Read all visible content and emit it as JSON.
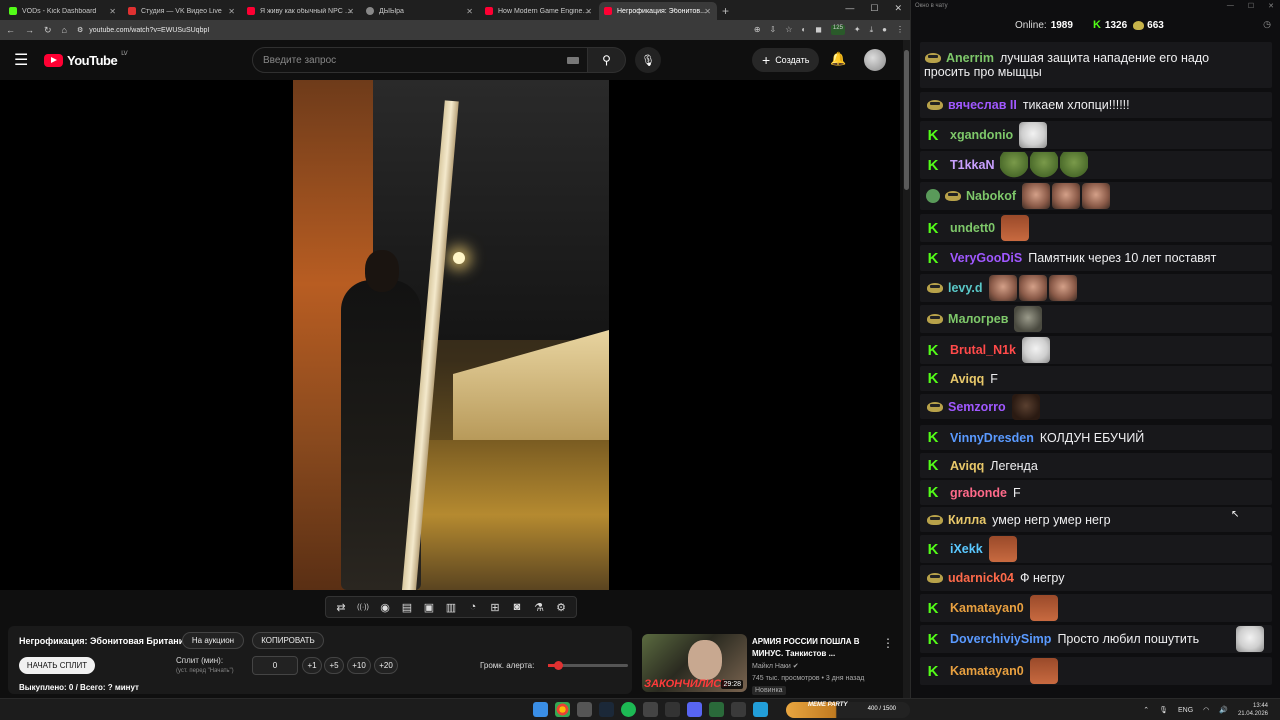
{
  "tabs": [
    {
      "title": "VODs - Kick Dashboard",
      "icon": "kick-icon",
      "active": false
    },
    {
      "title": "Студия — VK Видео Live",
      "icon": "vk-icon",
      "active": false
    },
    {
      "title": "Я живу как обычный NPC в Ki...",
      "icon": "youtube-icon",
      "active": false
    },
    {
      "title": "ДЫЫра",
      "icon": "globe-icon",
      "active": false
    },
    {
      "title": "How Modern Game Engines D...",
      "icon": "youtube-icon",
      "active": false
    },
    {
      "title": "Негрофикация: Эбонитов...",
      "icon": "youtube-icon",
      "active": true
    }
  ],
  "address": {
    "url": "youtube.com/watch?v=EWUSuSUqbpI",
    "ext_badge": "125"
  },
  "youtube": {
    "logo_text": "YouTube",
    "region": "LV",
    "search_placeholder": "Введите запрос",
    "create_label": "Создать"
  },
  "toolbar_icons": [
    "loop-icon",
    "broadcast-icon",
    "eye-icon",
    "clapper-icon",
    "pip-icon",
    "subtitles-icon",
    "speed-icon",
    "clip-icon",
    "camera-icon",
    "flask-icon",
    "settings-icon"
  ],
  "panel": {
    "title": "Негрофикация: Эбонитовая Британия.",
    "auction_label": "На аукцион",
    "copy_label": "КОПИРОВАТЬ",
    "start_split_label": "НАЧАТЬ СПЛИТ",
    "split_label": "Сплит (мин):",
    "split_hint": "(уст. перед \"Начать\")",
    "split_value": "0",
    "increments": [
      "+1",
      "+5",
      "+10",
      "+20"
    ],
    "alert_volume_label": "Громк. алерта:",
    "alert_volume": 0.12,
    "bought_text": "Выкуплено: 0 / Всего: ? минут"
  },
  "recommended": {
    "title": "АРМИЯ РОССИИ ПОШЛА В МИНУС. Танкистов ...",
    "channel": "Майкл Наки",
    "stats": "745 тыс. просмотров • 3 дня назад",
    "badge": "Новинка",
    "duration": "29:28",
    "thumb_caption": "ЗАКОНЧИЛИСЬ"
  },
  "chat_window": {
    "title": "Окно в чату",
    "online_label": "Online:",
    "online_count": "1989",
    "kick_count": "1326",
    "other_count": "663"
  },
  "chat": [
    {
      "badge": "pepe",
      "user": "Anerrim",
      "color": "#7ec86a",
      "text": "лучшая защита нападение его надо",
      "text2": "просить про мыщцы",
      "emotes": []
    },
    {
      "badge": "pepe",
      "user": "вячеслав II",
      "color": "#a058ff",
      "text": "тикаем хлопци!!!!!!",
      "emotes": []
    },
    {
      "badge": "kick",
      "user": "xgandonio",
      "color": "#7ec86a",
      "text": "",
      "emotes": [
        "e-cat"
      ]
    },
    {
      "badge": "kick",
      "user": "T1kkaN",
      "color": "#c9a0ff",
      "text": "",
      "emotes": [
        "e-pepe",
        "e-pepe",
        "e-pepe"
      ]
    },
    {
      "badge": "vpepe",
      "user": "Nabokof",
      "color": "#7ec86a",
      "text": "",
      "emotes": [
        "e-face",
        "e-face",
        "e-face"
      ]
    },
    {
      "badge": "kick",
      "user": "undett0",
      "color": "#7ec86a",
      "text": "",
      "emotes": [
        "e-red"
      ]
    },
    {
      "badge": "kick",
      "user": "VeryGooDiS",
      "color": "#a058ff",
      "text": "Памятник через 10 лет поставят",
      "emotes": []
    },
    {
      "badge": "pepe",
      "user": "levy.d",
      "color": "#5ac8c8",
      "text": "",
      "emotes": [
        "e-face",
        "e-face",
        "e-face"
      ]
    },
    {
      "badge": "pepe",
      "user": "Малогрев",
      "color": "#7ec86a",
      "text": "",
      "emotes": [
        "e-goat"
      ]
    },
    {
      "badge": "kick",
      "user": "Brutal_N1k",
      "color": "#ff4a4a",
      "text": "",
      "emotes": [
        "e-cat"
      ]
    },
    {
      "badge": "kick",
      "user": "Aviqq",
      "color": "#e8c86a",
      "text": "F",
      "emotes": []
    },
    {
      "badge": "pepe",
      "user": "Semzorro",
      "color": "#a058ff",
      "text": "",
      "emotes": [
        "e-dark"
      ]
    },
    {
      "badge": "kick",
      "user": "VinnyDresden",
      "color": "#5a9aff",
      "text": "КОЛДУН ЕБУЧИЙ",
      "emotes": []
    },
    {
      "badge": "kick",
      "user": "Aviqq",
      "color": "#e8c86a",
      "text": "Легенда",
      "emotes": []
    },
    {
      "badge": "kick",
      "user": "grabonde",
      "color": "#ff6a8a",
      "text": "F",
      "emotes": []
    },
    {
      "badge": "pepe",
      "user": "Килла",
      "color": "#e8c86a",
      "text": "умер негр умер негр",
      "emotes": []
    },
    {
      "badge": "kick",
      "user": "iXekk",
      "color": "#5ac8ff",
      "text": "",
      "emotes": [
        "e-red"
      ]
    },
    {
      "badge": "pepe",
      "user": "udarnick04",
      "color": "#ff6a4a",
      "text": "Ф негру",
      "emotes": []
    },
    {
      "badge": "kick",
      "user": "Kamatayan0",
      "color": "#e8a040",
      "text": "",
      "emotes": [
        "e-red"
      ]
    },
    {
      "badge": "kick",
      "user": "DoverchiviySimp",
      "color": "#5a9aff",
      "text": "Просто любил пошутить",
      "emotes": [
        "e-cat"
      ]
    },
    {
      "badge": "kick",
      "user": "Kamatayan0",
      "color": "#e8a040",
      "text": "",
      "emotes": [
        "e-red"
      ]
    }
  ],
  "taskbar": {
    "meme_party": "MEME PARTY",
    "progress_text": "400 / 1500",
    "lang": "ENG",
    "time": "13:44",
    "date": "21.04.2026"
  }
}
